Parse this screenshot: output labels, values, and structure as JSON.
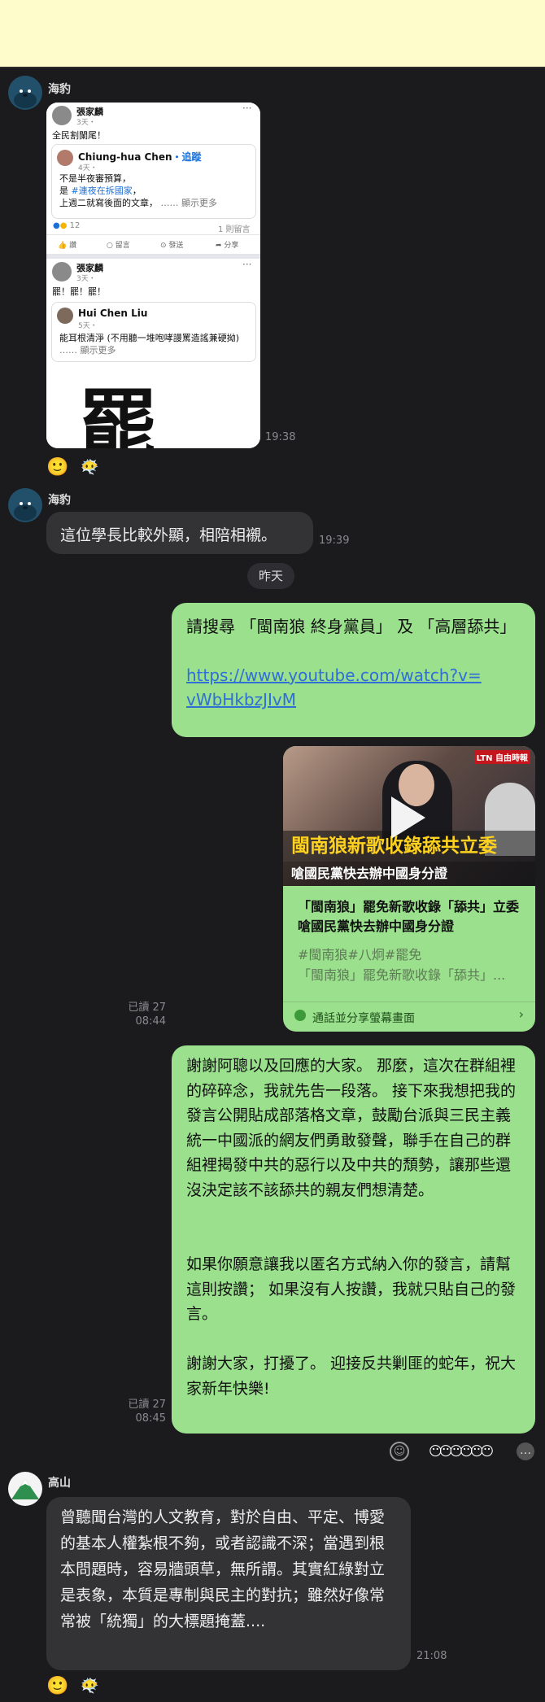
{
  "banner": {
    "color": "#fffccc"
  },
  "messages": {
    "m1": {
      "sender": "海豹",
      "time": "19:38",
      "post1": {
        "name": "張家麟",
        "meta": "3天・",
        "text": "全民割闌尾！",
        "shared_name": "Chiung-hua Chen",
        "shared_follow": "・追蹤",
        "shared_meta": "4天・",
        "shared_line1": "不是半夜審預算，",
        "shared_line2_pre": "是 ",
        "shared_line2_tag": "#連夜在拆國家",
        "shared_line2_post": "，",
        "shared_line3": "上週二就寫後面的文章，",
        "shared_more": "…… 顯示更多",
        "reactions": "12",
        "comments": "1 則留言",
        "actions": [
          "讚",
          "留言",
          "發送",
          "分享"
        ]
      },
      "post2": {
        "name": "張家麟",
        "meta": "3天・",
        "text": "罷！罷！罷！",
        "shared_name": "Hui Chen Liu",
        "shared_meta": "5天・",
        "shared_text": "能耳根清淨 (不用聽一堆咆哮謾罵造謠兼硬拗)",
        "shared_more": "…… 顯示更多",
        "big_char": "罷"
      }
    },
    "m2": {
      "sender": "海豹",
      "text": "這位學長比較外顯，相陪相襯。",
      "time": "19:39"
    },
    "date_separator": "昨天",
    "m3": {
      "text": "請搜尋 「閩南狼 終身黨員」 及 「高層舔共」",
      "link": "https://www.youtube.com/watch?v=vWbHkbzJIvM"
    },
    "m4": {
      "read": "已讀 27",
      "time": "08:44",
      "thumb_logo": "LTN 自由時報",
      "thumb_title": "閩南狼新歌收錄舔共立委",
      "thumb_sub": "嗆國民黨快去辦中國身分證",
      "title": "「閩南狼」罷免新歌收錄「舔共」立委 嗆國民黨快去辦中國身分證",
      "tags": "#閩南狼#八炯#罷免",
      "desc": "「閩南狼」罷免新歌收錄「舔共」...",
      "footer": "通話並分享螢幕畫面"
    },
    "m5": {
      "read": "已讀 27",
      "time": "08:45",
      "p1": "謝謝阿聰以及回應的大家。 那麼，這次在群組裡的碎碎念，我就先告一段落。 接下來我想把我的發言公開貼成部落格文章，鼓勵台派與三民主義統一中國派的網友們勇敢發聲，聯手在自己的群組裡揭發中共的惡行以及中共的頹勢，讓那些還沒決定該不該舔共的親友們想清楚。",
      "p2": "如果你願意讓我以匿名方式納入你的發言，請幫這則按讚； 如果沒有人按讚，我就只貼自己的發言。",
      "p3": "謝謝大家，打擾了。 迎接反共剿匪的蛇年，祝大家新年快樂!"
    },
    "m6": {
      "sender": "高山",
      "text": "曾聽聞台灣的人文教育，對於自由、平定、博愛的基本人權紮根不夠，或者認識不深；當遇到根本問題時，容易牆頭草，無所謂。其實紅綠對立是表象，本質是專制與民主的對抗；雖然好像常常被「統獨」的大標題掩蓋....",
      "time": "21:08"
    }
  },
  "reactions": {
    "smile": "🙂",
    "add_reaction": "☺",
    "more": "…"
  },
  "colors": {
    "background": "#1b1b1e",
    "bubble_out": "#9ae08d",
    "bubble_in": "#333336",
    "link": "#2f6fd6"
  }
}
